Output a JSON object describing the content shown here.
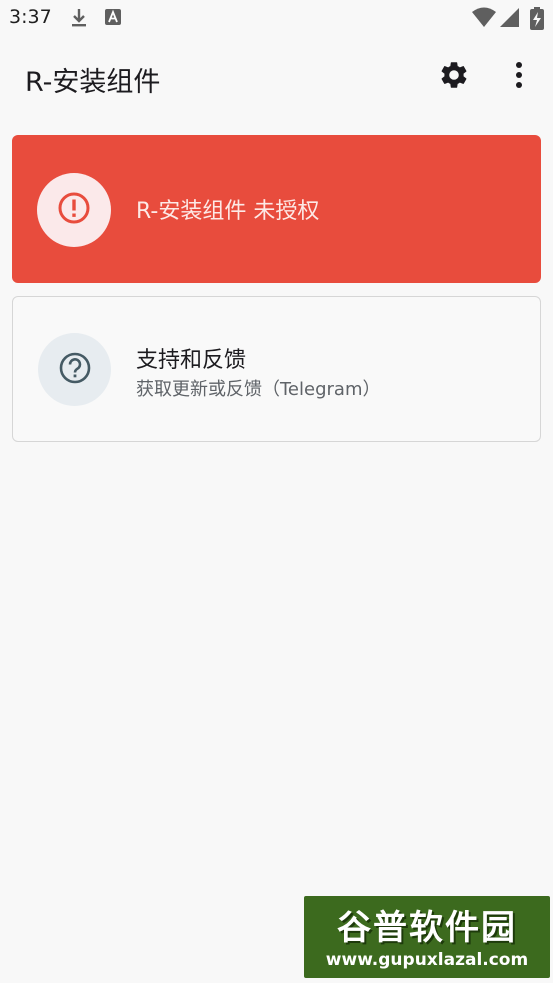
{
  "status_bar": {
    "time": "3:37",
    "icons": [
      "download-icon",
      "a-notification-icon",
      "wifi-icon",
      "signal-icon",
      "battery-charging-icon"
    ]
  },
  "app_bar": {
    "title": "R-安装组件",
    "actions": [
      "settings-icon",
      "more-vert-icon"
    ]
  },
  "alert_card": {
    "label": "R-安装组件 未授权",
    "icon": "error-icon",
    "color": "#e84c3d"
  },
  "support_card": {
    "title": "支持和反馈",
    "subtitle": "获取更新或反馈（Telegram）",
    "icon": "help-icon"
  },
  "watermark": {
    "name": "谷普软件园",
    "url": "www.gupuxlazal.com"
  }
}
